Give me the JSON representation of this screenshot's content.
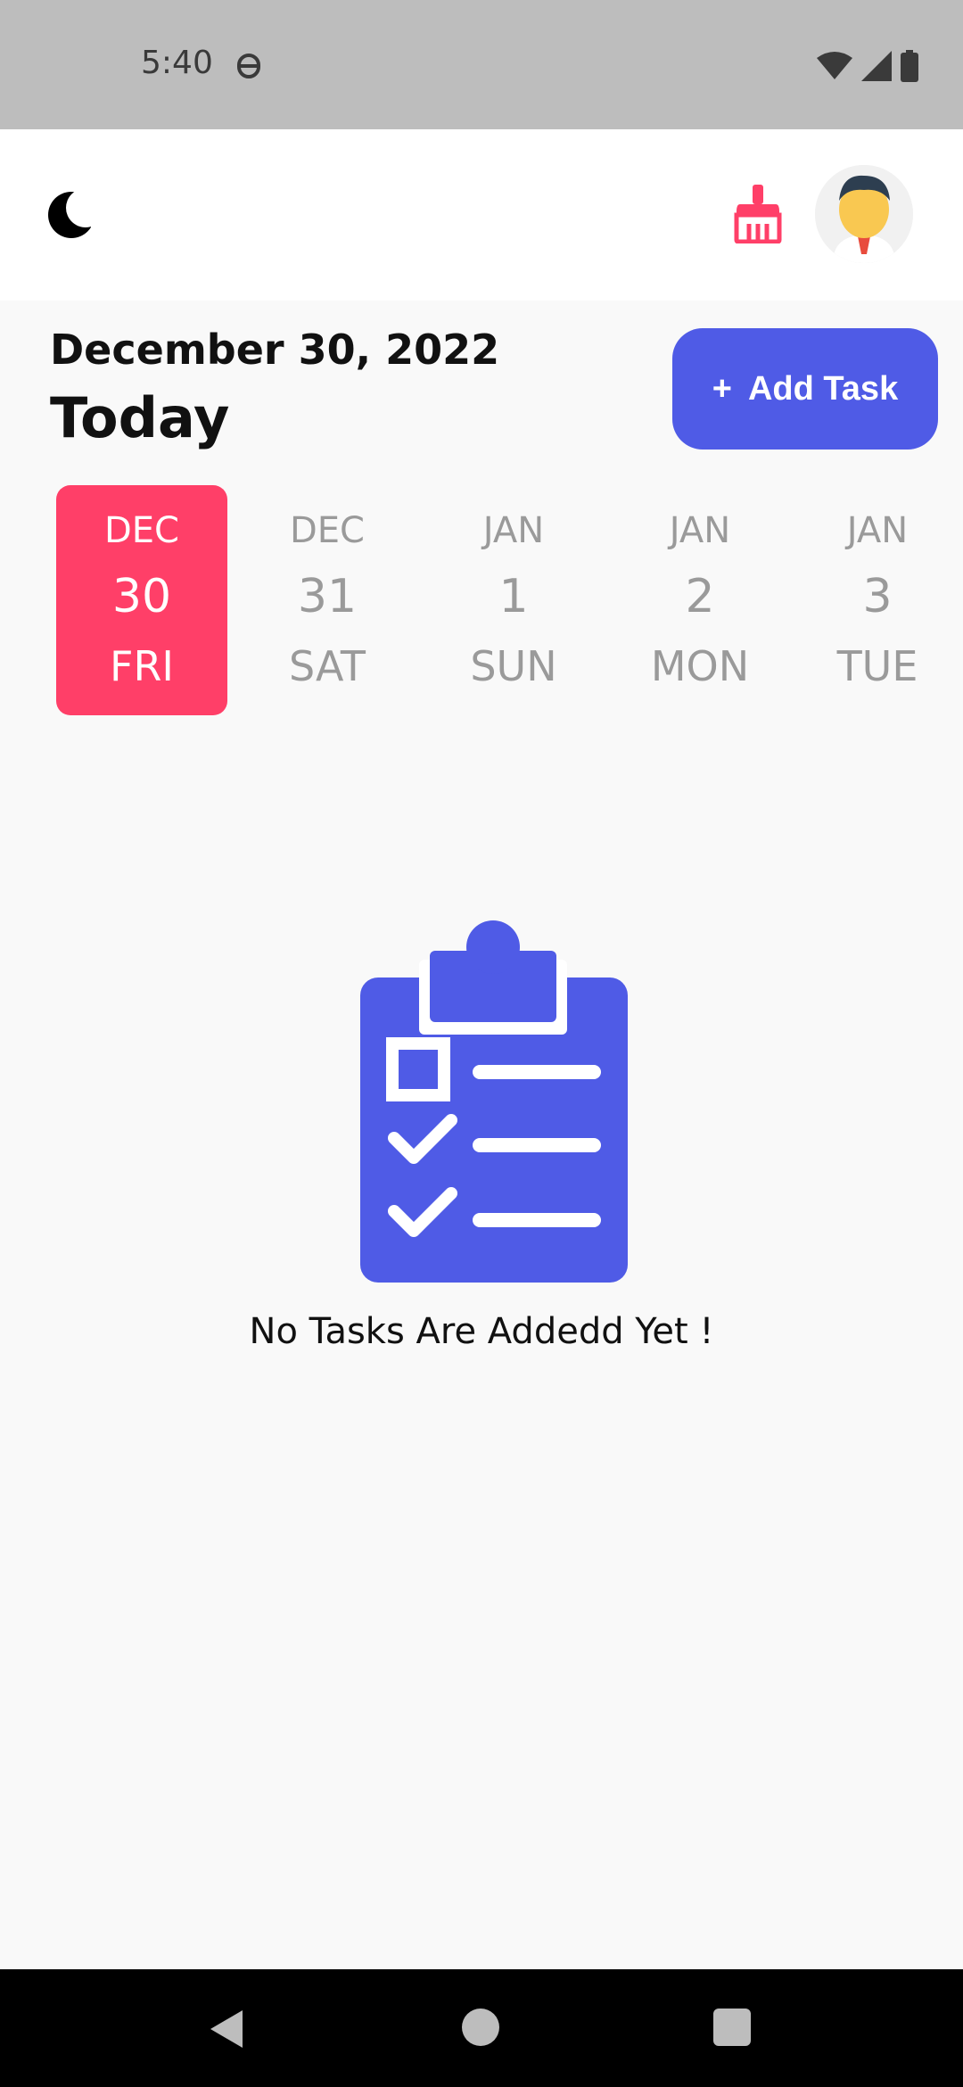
{
  "status_bar": {
    "time": "5:40",
    "icons": [
      "notification-icon",
      "wifi-icon",
      "signal-icon",
      "battery-icon"
    ]
  },
  "app_bar": {
    "theme_icon": "moon-icon",
    "clean_icon": "broom-icon",
    "avatar": "avatar"
  },
  "header": {
    "date": "December 30, 2022",
    "title": "Today",
    "add_task_icon": "+",
    "add_task_label": "Add Task"
  },
  "date_strip": {
    "items": [
      {
        "month": "DEC",
        "day": "30",
        "weekday": "FRI",
        "selected": true
      },
      {
        "month": "DEC",
        "day": "31",
        "weekday": "SAT",
        "selected": false
      },
      {
        "month": "JAN",
        "day": "1",
        "weekday": "SUN",
        "selected": false
      },
      {
        "month": "JAN",
        "day": "2",
        "weekday": "MON",
        "selected": false
      },
      {
        "month": "JAN",
        "day": "3",
        "weekday": "TUE",
        "selected": false
      }
    ]
  },
  "empty_state": {
    "icon": "clipboard-checklist-icon",
    "message": "No Tasks Are Addedd Yet !"
  },
  "colors": {
    "accent": "#4f5be6",
    "selected_date": "#ff3f68",
    "broom": "#ff3f68"
  },
  "nav_bar": {
    "icons": [
      "back-icon",
      "home-icon",
      "recents-icon"
    ]
  }
}
